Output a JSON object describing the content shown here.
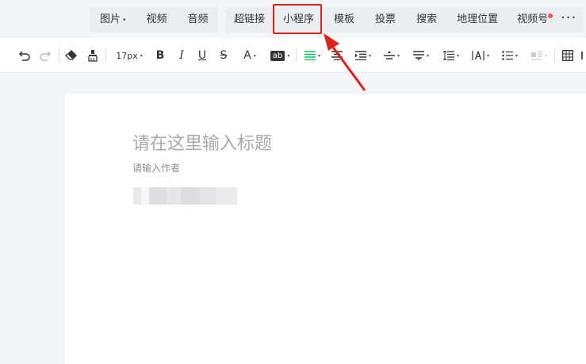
{
  "insert_bar": {
    "media_group": [
      {
        "label": "图片",
        "has_caret": true
      },
      {
        "label": "视频"
      },
      {
        "label": "音频"
      }
    ],
    "items": [
      {
        "label": "超链接"
      },
      {
        "label": "小程序"
      },
      {
        "label": "模板"
      },
      {
        "label": "投票"
      },
      {
        "label": "搜索"
      },
      {
        "label": "地理位置"
      },
      {
        "label": "视频号",
        "badge": "red-dot"
      }
    ],
    "more_label": "···",
    "caret": "▾"
  },
  "toolbar": {
    "font_size": "17px",
    "bold": "B",
    "italic": "I",
    "underline": "U",
    "strikethrough": "S",
    "font_color": "A",
    "bg_color": "ab",
    "caret": "▾"
  },
  "editor": {
    "title_placeholder": "请在这里输入标题",
    "author_placeholder": "请输入作者"
  },
  "colors": {
    "accent_green": "#07c160",
    "annotation_red": "#e0201b",
    "badge_red": "#fa5151"
  }
}
